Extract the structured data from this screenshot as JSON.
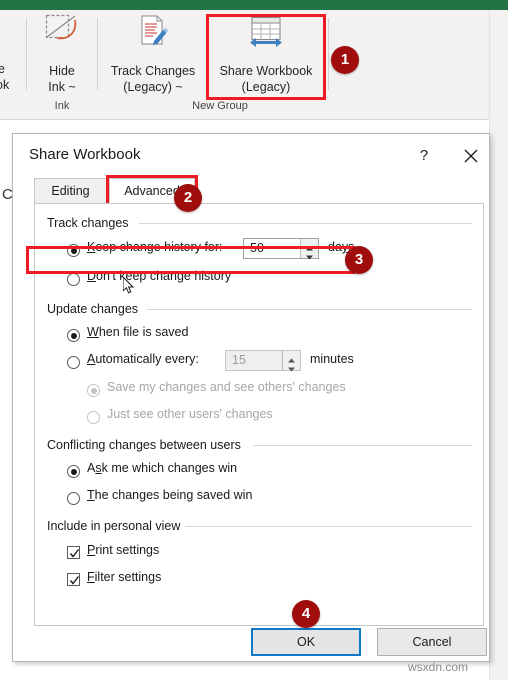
{
  "app": {
    "accent_green": "#217346",
    "highlight_red": "#ED1C24",
    "badge_red": "#A00D0D",
    "focus_blue": "#0f7ac7"
  },
  "ribbon": {
    "cut_left_line1": "e",
    "cut_left_line2": "ok",
    "items": [
      {
        "label_line1": "Hide",
        "label_line2": "Ink ~",
        "icon": "hide-ink-icon"
      },
      {
        "label_line1": "Track Changes",
        "label_line2": "(Legacy) ~",
        "icon": "track-changes-icon"
      },
      {
        "label_line1": "Share Workbook",
        "label_line2": "(Legacy)",
        "icon": "share-workbook-icon"
      }
    ],
    "groups": [
      {
        "label": "Ink"
      },
      {
        "label": "New Group"
      }
    ],
    "background_cell_letter": "C"
  },
  "dialog": {
    "title": "Share Workbook",
    "help_icon": "?",
    "close_icon": "close-icon",
    "tabs": [
      {
        "label": "Editing",
        "selected": false
      },
      {
        "label": "Advanced",
        "selected": true
      }
    ],
    "sections": {
      "track_changes": {
        "legend": "Track changes",
        "keep_history": {
          "label_pre": "K",
          "label_post": "eep change history for:",
          "value": "50",
          "unit_pre": "da",
          "unit_mid": "y",
          "unit_post": "s",
          "selected": true
        },
        "dont_keep": {
          "label_pre": "D",
          "label_post": "on't keep change history",
          "selected": false
        }
      },
      "update_changes": {
        "legend": "Update changes",
        "when_saved": {
          "label_pre": "W",
          "label_post": "hen file is saved",
          "selected": true
        },
        "automatically": {
          "label_pre": "A",
          "label_post": "utomatically every:",
          "value": "15",
          "unit": "minutes",
          "selected": false,
          "disabled": false
        },
        "save_and_see": {
          "label": "Save my changes and see others' changes",
          "selected": true,
          "disabled": true
        },
        "just_see": {
          "label": "Just see other users' changes",
          "selected": false,
          "disabled": true
        }
      },
      "conflicting_changes": {
        "legend": "Conflicting changes between users",
        "ask_me": {
          "label_pre": "A",
          "label_mid": "s",
          "label_post": "k me which changes win",
          "selected": true
        },
        "saved_win": {
          "label_pre": "T",
          "label_post": "he changes being saved win",
          "selected": false
        }
      },
      "personal_view": {
        "legend": "Include in personal view",
        "print_settings": {
          "label_pre": "P",
          "label_post": "rint settings",
          "checked": true
        },
        "filter_settings": {
          "label_pre": "F",
          "label_post": "ilter settings",
          "checked": true
        }
      }
    },
    "buttons": {
      "ok": "OK",
      "cancel": "Cancel"
    }
  },
  "callouts": [
    {
      "number": "1"
    },
    {
      "number": "2"
    },
    {
      "number": "3"
    },
    {
      "number": "4"
    }
  ],
  "watermark": "wsxdn.com"
}
